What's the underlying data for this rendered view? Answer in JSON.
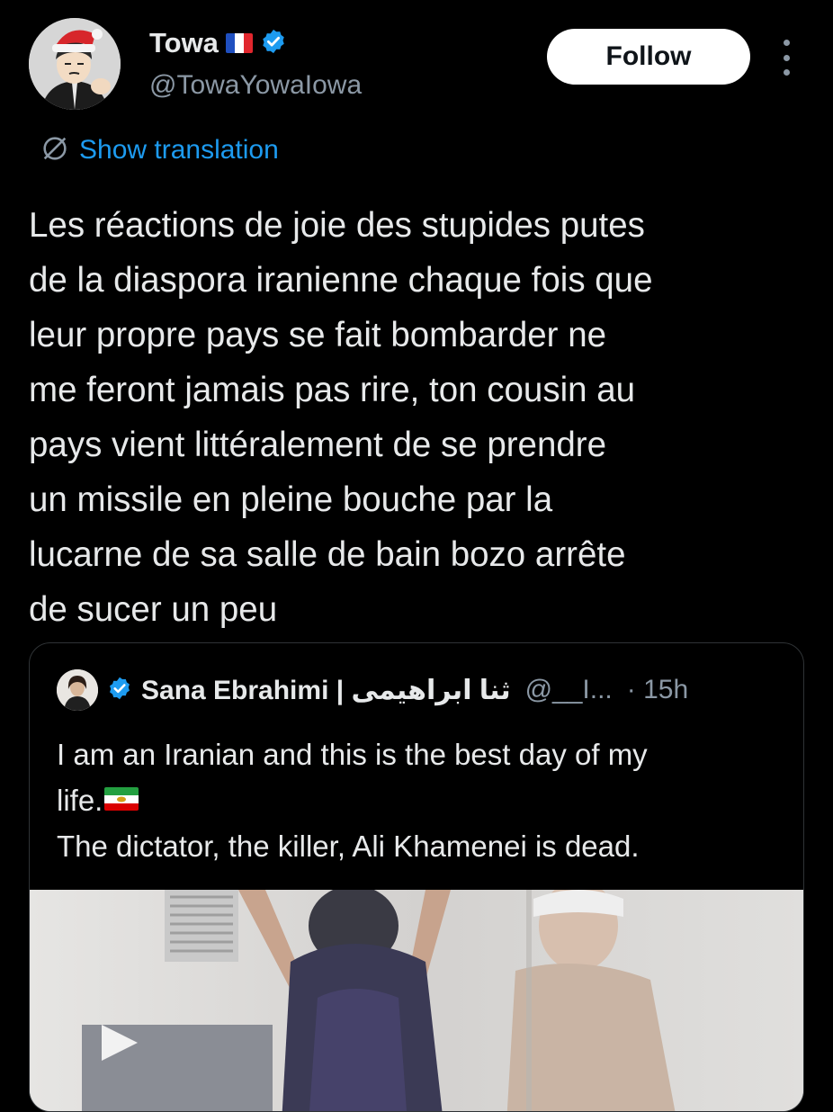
{
  "user": {
    "display_name": "Towa",
    "handle": "@TowaYowaIowa",
    "flag": "france-flag",
    "verified_icon": "verified-badge-icon"
  },
  "actions": {
    "follow_label": "Follow",
    "more_icon": "more-vertical-icon"
  },
  "translation": {
    "icon": "translate-globe-icon",
    "label": "Show translation"
  },
  "tweet": {
    "text": "Les réactions de joie des stupides putes\nde la diaspora iranienne chaque fois que\nleur propre pays se fait bombarder ne\nme feront jamais pas rire, ton cousin au\npays vient littéralement de se prendre\nun missile en pleine bouche par la\nlucarne de sa salle de bain bozo arrête\nde sucer un peu"
  },
  "quote": {
    "display_name": "Sana Ebrahimi | ثنا ابراهیمی",
    "handle": "@__I...",
    "time": "· 15h",
    "lines": [
      "I am an Iranian and this is the best day of my",
      "life.",
      "The dictator, the killer, Ali Khamenei is dead."
    ],
    "flag": "iran-lion-sun-flag",
    "media": "video-thumbnail"
  },
  "colors": {
    "background": "#000000",
    "text": "#e7e9ea",
    "secondary": "#8b98a5",
    "accent": "#1d9bf0",
    "border": "#2f3336"
  }
}
